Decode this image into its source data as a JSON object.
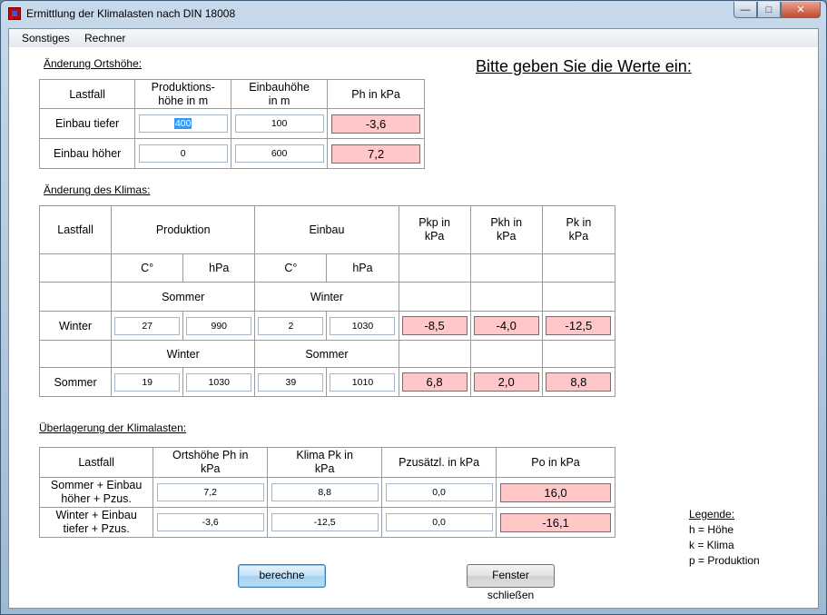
{
  "window": {
    "title": "Ermittlung der Klimalasten nach DIN 18008"
  },
  "menu": {
    "items": [
      "Sonstiges",
      "Rechner"
    ]
  },
  "prompt": "Bitte geben Sie die Werte ein:",
  "ortshoehe": {
    "label": "Änderung Ortshöhe:",
    "headers": {
      "lastfall": "Lastfall",
      "produktion": "Produktions-\nhöhe in m",
      "einbau": "Einbauhöhe\nin m",
      "ph": "Ph  in kPa"
    },
    "rows": [
      {
        "label": "Einbau tiefer",
        "produktion": "400",
        "einbau": "100",
        "ph": "-3,6"
      },
      {
        "label": "Einbau höher",
        "produktion": "0",
        "einbau": "600",
        "ph": "7,2"
      }
    ]
  },
  "klima": {
    "label": "Änderung des Klimas:",
    "headers": {
      "lastfall": "Lastfall",
      "produktion": "Produktion",
      "einbau": "Einbau",
      "pkp": "Pkp  in\nkPa",
      "pkh": "Pkh  in\nkPa",
      "pk": "Pk  in\nkPa"
    },
    "units": {
      "c": "C°",
      "hpa": "hPa"
    },
    "winter": {
      "season_prod": "Sommer",
      "season_einbau": "Winter",
      "label": "Winter",
      "prod_c": "27",
      "prod_hpa": "990",
      "einbau_c": "2",
      "einbau_hpa": "1030",
      "pkp": "-8,5",
      "pkh": "-4,0",
      "pk": "-12,5"
    },
    "sommer": {
      "season_prod": "Winter",
      "season_einbau": "Sommer",
      "label": "Sommer",
      "prod_c": "19",
      "prod_hpa": "1030",
      "einbau_c": "39",
      "einbau_hpa": "1010",
      "pkp": "6,8",
      "pkh": "2,0",
      "pk": "8,8"
    }
  },
  "ueberlagerung": {
    "label": "Überlagerung der Klimalasten:",
    "headers": {
      "lastfall": "Lastfall",
      "ph": "Ortshöhe Ph in\nkPa",
      "pk": "Klima  Pk     in\nkPa",
      "pz": "Pzusätzl.  in kPa",
      "po": "Po    in kPa"
    },
    "rows": [
      {
        "label": "Sommer + Einbau\nhöher + Pzus.",
        "ph": "7,2",
        "pk": "8,8",
        "pz": "0,0",
        "po": "16,0"
      },
      {
        "label": "Winter + Einbau\ntiefer + Pzus.",
        "ph": "-3,6",
        "pk": "-12,5",
        "pz": "0,0",
        "po": "-16,1"
      }
    ]
  },
  "legend": {
    "title": "Legende:",
    "items": [
      "h = Höhe",
      "k = Klima",
      "p = Produktion"
    ]
  },
  "buttons": {
    "calc": "berechne",
    "close": "Fenster schließen"
  }
}
